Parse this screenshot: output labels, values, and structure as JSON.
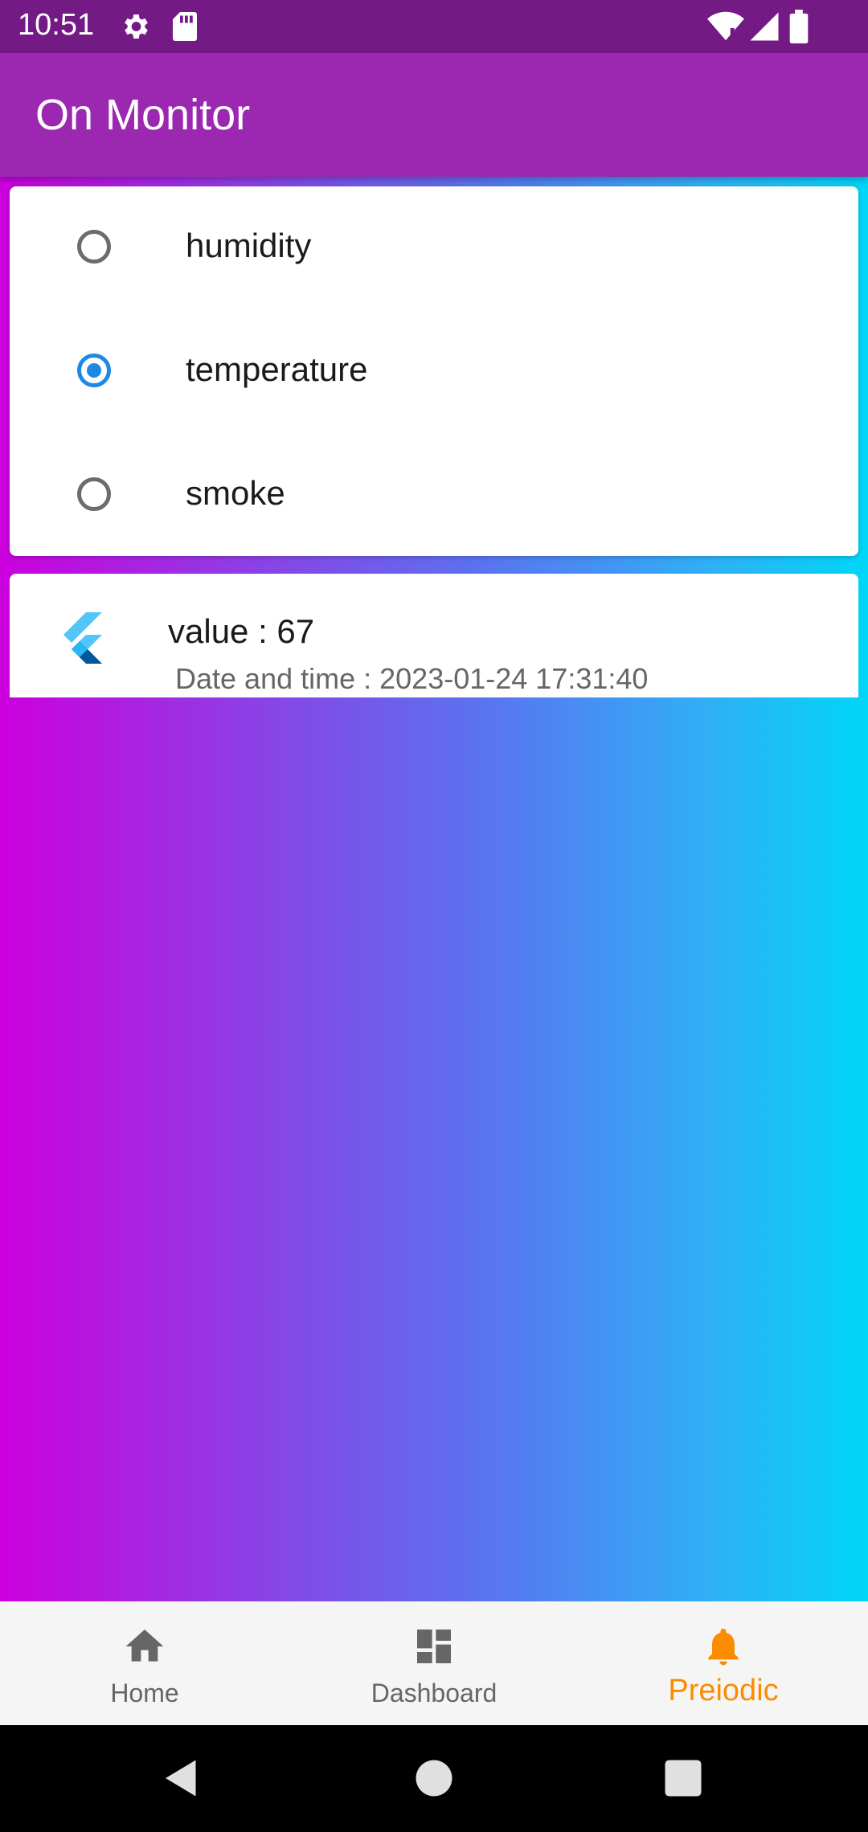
{
  "status_bar": {
    "time": "10:51",
    "left_icons": [
      "settings-icon",
      "sd-card-icon"
    ],
    "right_icons": [
      "wifi-icon",
      "signal-icon",
      "battery-icon"
    ]
  },
  "app_bar": {
    "title": "On Monitor"
  },
  "sensor_options": [
    {
      "label": "humidity",
      "selected": false
    },
    {
      "label": "temperature",
      "selected": true
    },
    {
      "label": "smoke",
      "selected": false
    }
  ],
  "reading": {
    "icon": "flutter-logo-icon",
    "value_text": "value : 67",
    "datetime_text": "Date and time : 2023-01-24 17:31:40"
  },
  "bottom_nav": {
    "items": [
      {
        "label": "Home",
        "icon": "home-icon",
        "active": false
      },
      {
        "label": "Dashboard",
        "icon": "dashboard-icon",
        "active": false
      },
      {
        "label": "Preiodic",
        "icon": "bell-icon",
        "active": true
      }
    ]
  },
  "colors": {
    "status_bar": "#741a85",
    "app_bar": "#9c27b0",
    "radio_selected": "#1e88e5",
    "nav_active": "#fb8c00",
    "gradient_start": "#cc00dd",
    "gradient_end": "#00d6f7"
  }
}
